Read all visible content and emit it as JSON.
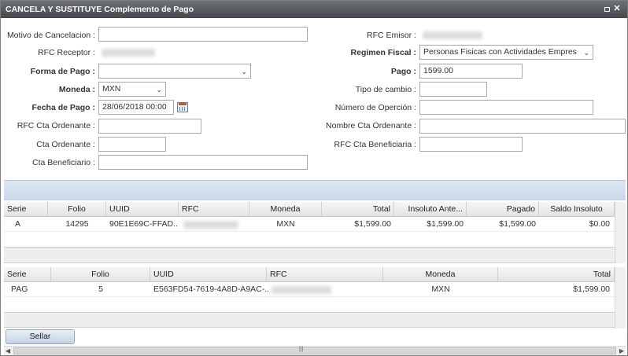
{
  "window": {
    "title": "CANCELA Y SUSTITUYE Complemento de Pago"
  },
  "form": {
    "motivo_label": "Motivo de Cancelacion :",
    "motivo_value": "",
    "rfc_receptor_label": "RFC Receptor :",
    "forma_pago_label": "Forma de Pago :",
    "forma_pago_value": "",
    "moneda_label": "Moneda :",
    "moneda_value": "MXN",
    "fecha_pago_label": "Fecha de Pago :",
    "fecha_pago_value": "28/06/2018 00:00",
    "rfc_cta_ordenante_label": "RFC Cta Ordenante :",
    "cta_ordenante_label": "Cta Ordenante :",
    "cta_beneficiario_label": "Cta Beneficiario :",
    "rfc_emisor_label": "RFC Emisor :",
    "regimen_fiscal_label": "Regimen Fiscal :",
    "regimen_fiscal_value": "Personas Fisicas con Actividades Empres",
    "pago_label": "Pago :",
    "pago_value": "1599.00",
    "tipo_cambio_label": "Tipo de cambio :",
    "numero_operacion_label": "Número de Operción :",
    "nombre_cta_ordenante_label": "Nombre Cta Ordenante :",
    "rfc_cta_beneficiaria_label": "RFC Cta Beneficiaria :"
  },
  "grid1": {
    "headers": [
      "Serie",
      "Folio",
      "UUID",
      "RFC",
      "Moneda",
      "Total",
      "Insoluto Ante...",
      "Pagado",
      "Saldo Insoluto"
    ],
    "rows": [
      [
        "A",
        "14295",
        "90E1E69C-FFAD...",
        "",
        "MXN",
        "$1,599.00",
        "$1,599.00",
        "$1,599.00",
        "$0.00"
      ]
    ]
  },
  "grid2": {
    "headers": [
      "Serie",
      "Folio",
      "UUID",
      "RFC",
      "Moneda",
      "Total"
    ],
    "rows": [
      [
        "PAG",
        "5",
        "E563FD54-7619-4A8D-A9AC-...",
        "",
        "MXN",
        "$1,599.00"
      ]
    ]
  },
  "buttons": {
    "sellar": "Sellar"
  },
  "icons": {
    "close": "close-icon",
    "restore": "restore-icon",
    "calendar": "calendar-icon",
    "dropdown": "chevron-down-icon"
  }
}
